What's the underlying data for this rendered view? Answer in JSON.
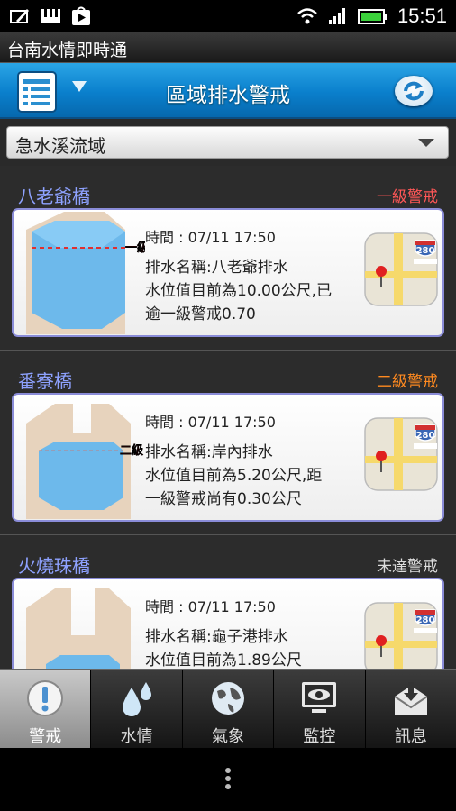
{
  "status_bar": {
    "time": "15:51"
  },
  "app": {
    "title": "台南水情即時通"
  },
  "header": {
    "title": "區域排水警戒"
  },
  "filter": {
    "selected": "急水溪流域"
  },
  "stations": [
    {
      "name": "八老爺橋",
      "level": "一級警戒",
      "level_color": "#ff5757",
      "gauge_mark": "一級",
      "time": "時間 : 07/11 17:50",
      "line1": "排水名稱:八老爺排水",
      "line2": "水位值目前為10.00公尺,已",
      "line3": "逾一級警戒0.70"
    },
    {
      "name": "番寮橋",
      "level": "二級警戒",
      "level_color": "#ff8a20",
      "gauge_mark": "二級",
      "time": "時間 : 07/11 17:50",
      "line1": "排水名稱:岸內排水",
      "line2": "水位值目前為5.20公尺,距",
      "line3": "一級警戒尚有0.30公尺"
    },
    {
      "name": "火燒珠橋",
      "level": "未達警戒",
      "level_color": "#dddddd",
      "gauge_mark": "",
      "time": "時間 : 07/11 17:50",
      "line1": "排水名稱:龜子港排水",
      "line2": "水位值目前為1.89公尺",
      "line3": ""
    }
  ],
  "map_label": "280",
  "tabs": [
    {
      "label": "警戒",
      "icon": "alert-icon"
    },
    {
      "label": "水情",
      "icon": "water-drops-icon"
    },
    {
      "label": "氣象",
      "icon": "globe-icon"
    },
    {
      "label": "監控",
      "icon": "monitor-eye-icon"
    },
    {
      "label": "訊息",
      "icon": "mail-download-icon"
    }
  ]
}
